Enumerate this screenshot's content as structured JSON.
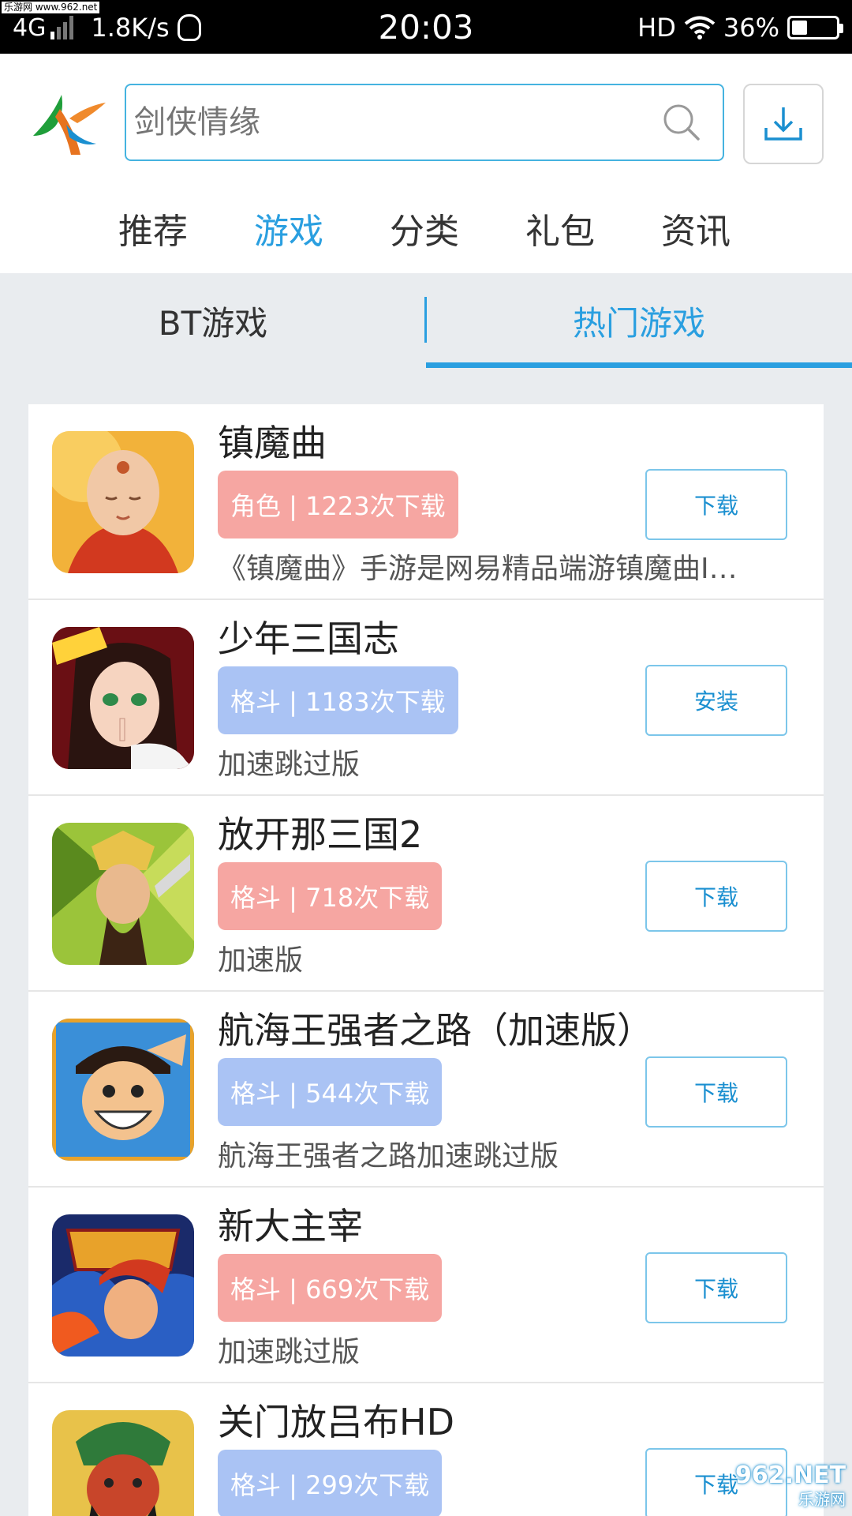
{
  "status_bar": {
    "watermark": "乐游网 www.962.net",
    "network": "4G",
    "speed": "1.8K/s",
    "time": "20:03",
    "hd": "HD",
    "battery": "36%",
    "battery_level": 0.36
  },
  "header": {
    "search_placeholder": "剑侠情缘"
  },
  "nav": {
    "items": [
      "推荐",
      "游戏",
      "分类",
      "礼包",
      "资讯"
    ],
    "active": "游戏"
  },
  "subtabs": {
    "items": [
      "BT游戏",
      "热门游戏"
    ],
    "active": "热门游戏"
  },
  "games": [
    {
      "title": "镇魔曲",
      "tag": "角色 | 1223次下载",
      "tag_color": "#f6a6a2",
      "desc": "《镇魔曲》手游是网易精品端游镇魔曲I…",
      "action": "下载",
      "icon": "bald-monk-icon"
    },
    {
      "title": "少年三国志",
      "tag": "格斗 | 1183次下载",
      "tag_color": "#aac3f4",
      "desc": "加速跳过版",
      "action": "安装",
      "icon": "anime-girl-icon"
    },
    {
      "title": "放开那三国2",
      "tag": "格斗 | 718次下载",
      "tag_color": "#f6a6a2",
      "desc": "加速版",
      "action": "下载",
      "icon": "armored-warrior-icon"
    },
    {
      "title": "航海王强者之路（加速版）",
      "tag": "格斗 | 544次下载",
      "tag_color": "#aac3f4",
      "desc": "航海王强者之路加速跳过版",
      "action": "下载",
      "icon": "pirate-boy-icon"
    },
    {
      "title": "新大主宰",
      "tag": "格斗 | 669次下载",
      "tag_color": "#f6a6a2",
      "desc": "加速跳过版",
      "action": "下载",
      "icon": "fire-hero-icon"
    },
    {
      "title": "关门放吕布HD",
      "tag": "格斗 | 299次下载",
      "tag_color": "#aac3f4",
      "desc": "",
      "action": "下载",
      "icon": "general-icon"
    }
  ],
  "corner_watermark": {
    "top": "962.NET",
    "bottom": "乐游网"
  },
  "colors": {
    "accent": "#2a9fe0",
    "tag_red": "#f6a6a2",
    "tag_blue": "#aac3f4"
  }
}
